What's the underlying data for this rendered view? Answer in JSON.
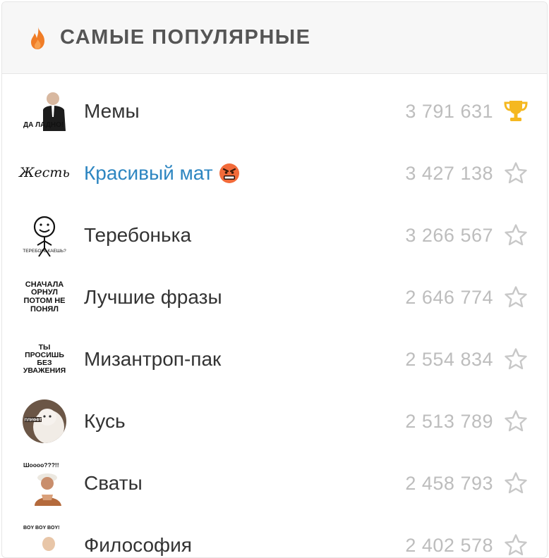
{
  "header": {
    "title": "САМЫЕ ПОПУЛЯРНЫЕ",
    "icon": "flame-icon",
    "accent": "#f07d27"
  },
  "packs": [
    {
      "name": "Мемы",
      "count": "3 791 631",
      "rank": "trophy",
      "sticker_text": "ДА ЛАДНО!",
      "link": false
    },
    {
      "name": "Красивый мат",
      "count": "3 427 138",
      "rank": "star",
      "sticker_text": "Жесть",
      "link": true,
      "emoji": "angry-face"
    },
    {
      "name": "Теребонька",
      "count": "3 266 567",
      "rank": "star",
      "sticker_text": "ТЕРЕБОНЬКАЕШЬ?",
      "link": false
    },
    {
      "name": "Лучшие фразы",
      "count": "2 646 774",
      "rank": "star",
      "sticker_text": "СНАЧАЛА ОРНУЛ ПОТОМ НЕ ПОНЯЛ",
      "link": false
    },
    {
      "name": "Мизантроп-пак",
      "count": "2 554 834",
      "rank": "star",
      "sticker_text": "ТЫ ПРОСИШЬ БЕЗ УВАЖЕНИЯ",
      "link": false
    },
    {
      "name": "Кусь",
      "count": "2 513 789",
      "rank": "star",
      "sticker_text": "ПЛИФФТ",
      "link": false
    },
    {
      "name": "Сваты",
      "count": "2 458 793",
      "rank": "star",
      "sticker_text": "Шоооо???!!",
      "link": false
    },
    {
      "name": "Философия",
      "count": "2 402 578",
      "rank": "star",
      "sticker_text": "BOY BOY BOY!",
      "link": false
    }
  ],
  "colors": {
    "trophy": "#f5b820",
    "star": "#c8c8c8",
    "link": "#2e86c1"
  }
}
